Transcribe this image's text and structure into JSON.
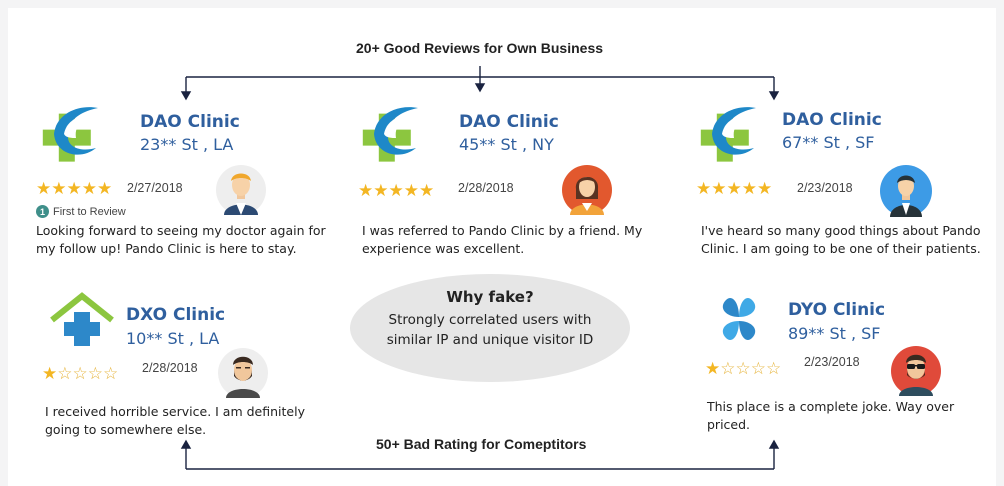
{
  "top_heading": "20+ Good Reviews for Own Business",
  "bottom_heading": "50+ Bad Rating for Comeptitors",
  "why_fake": {
    "title": "Why fake?",
    "line1": "Strongly correlated users with",
    "line2": "similar IP and unique visitor ID"
  },
  "good_reviews": [
    {
      "clinic": "DAO Clinic",
      "address": "23** St , LA",
      "stars": 5,
      "date": "2/27/2018",
      "badge": "First to Review",
      "text": "Looking forward to seeing my doctor again for my follow up! Pando Clinic is here to stay.",
      "avatar": "man-blond-avatar-icon"
    },
    {
      "clinic": "DAO Clinic",
      "address": "45** St , NY",
      "stars": 5,
      "date": "2/28/2018",
      "text": "I was referred to Pando Clinic by a friend. My experience was excellent.",
      "avatar": "woman-avatar-icon"
    },
    {
      "clinic": "DAO Clinic",
      "address": "67** St , SF",
      "stars": 5,
      "date": "2/23/2018",
      "text": "I've heard so many good things about Pando Clinic. I am going to be one of their patients.",
      "avatar": "man-suit-avatar-icon"
    }
  ],
  "bad_reviews": [
    {
      "clinic": "DXO Clinic",
      "address": "10** St , LA",
      "stars": 1,
      "date": "2/28/2018",
      "text": "I received horrible service. I am definitely going to somewhere else.",
      "avatar": "bearded-man-avatar-icon"
    },
    {
      "clinic": "DYO Clinic",
      "address": "89** St , SF",
      "stars": 1,
      "date": "2/23/2018",
      "text": "This place is a complete joke. Way over priced.",
      "avatar": "sunglasses-man-avatar-icon"
    }
  ],
  "colors": {
    "clinic_blue": "#2f5f9e",
    "star_gold": "#f3b623",
    "cross_green": "#8cc63f",
    "swoosh_blue": "#1e88c8",
    "ellipse_gray": "#e6e6e6"
  }
}
